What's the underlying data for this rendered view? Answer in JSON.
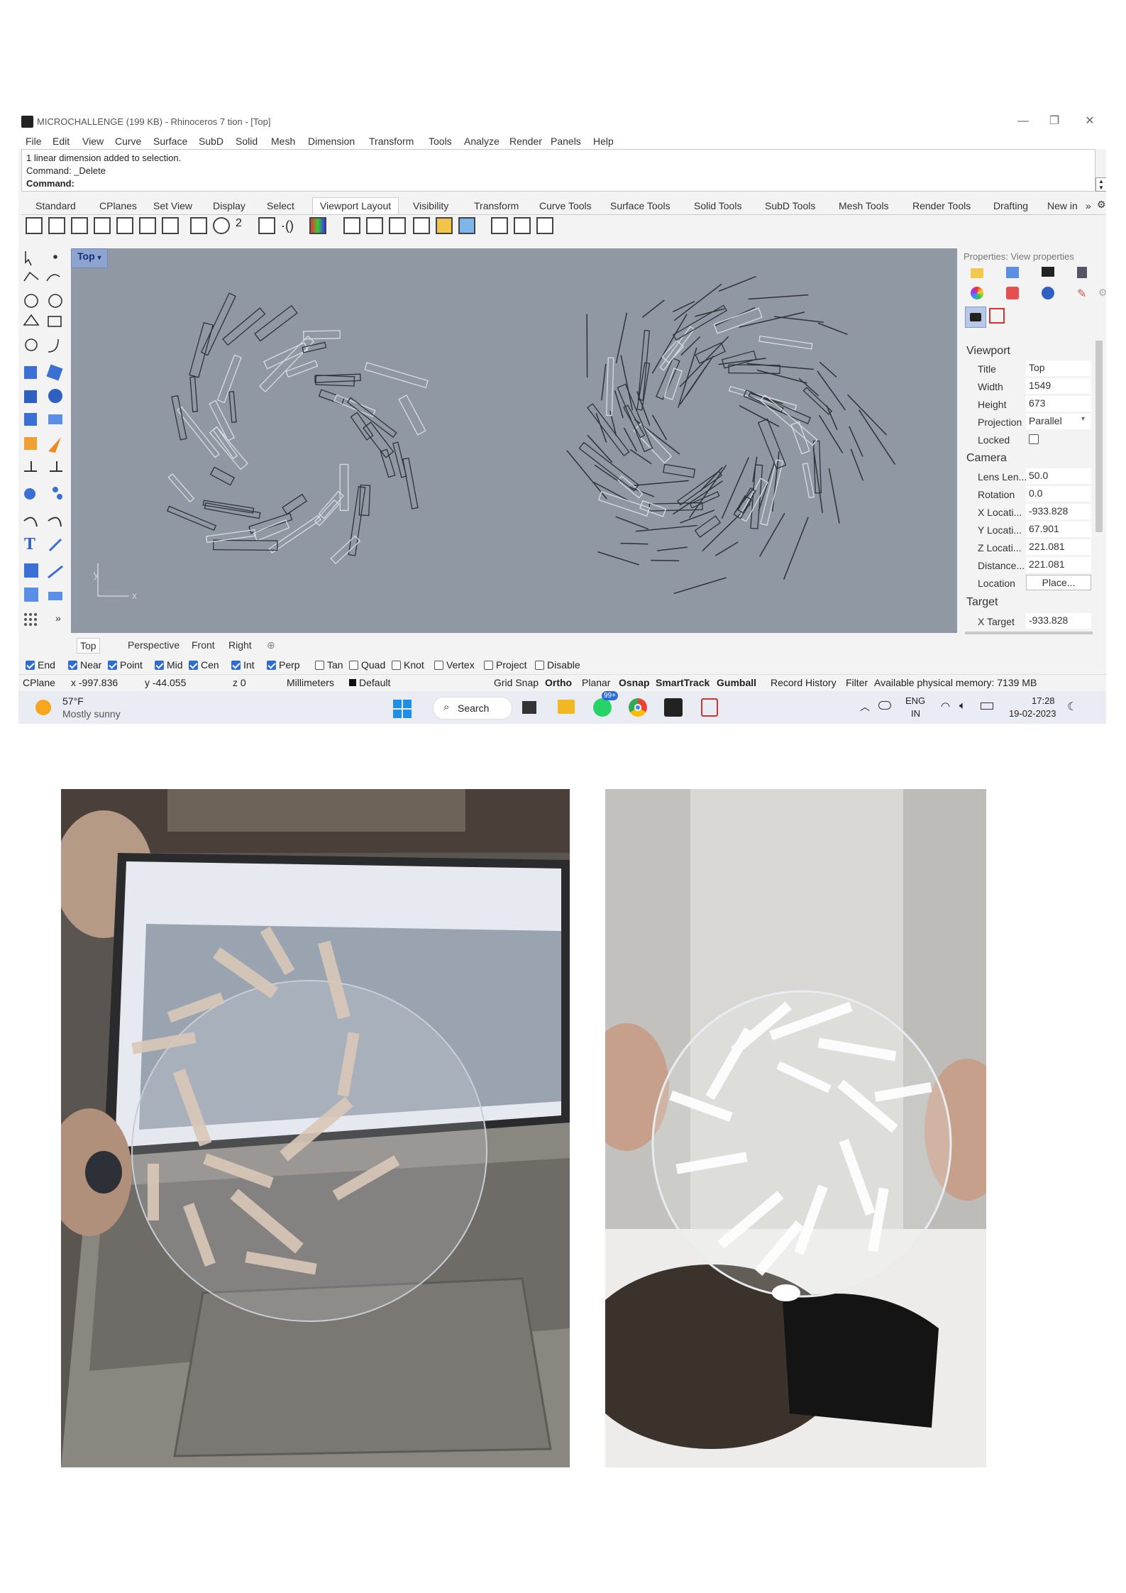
{
  "window": {
    "title": "MICROCHALLENGE (199 KB) - Rhinoceros 7 tion - [Top]",
    "minimize": "—",
    "restore": "❐",
    "close": "✕"
  },
  "menu": [
    "File",
    "Edit",
    "View",
    "Curve",
    "Surface",
    "SubD",
    "Solid",
    "Mesh",
    "Dimension",
    "Transform",
    "Tools",
    "Analyze",
    "Render",
    "Panels",
    "Help"
  ],
  "command": {
    "line1": "1 linear dimension added to selection.",
    "line2": "Command: _Delete",
    "prompt": "Command:"
  },
  "toolbar_tabs": [
    "Standard",
    "CPlanes",
    "Set View",
    "Display",
    "Select",
    "Viewport Layout",
    "Visibility",
    "Transform",
    "Curve Tools",
    "Surface Tools",
    "Solid Tools",
    "SubD Tools",
    "Mesh Tools",
    "Render Tools",
    "Drafting",
    "New in"
  ],
  "toolbar_tabs_more": "»",
  "active_tab": "Viewport Layout",
  "viewport": {
    "label": "Top",
    "axis_y": "y",
    "axis_x": "x",
    "bg_color": "#8f98a3"
  },
  "viewport_tabs": [
    "Top",
    "Perspective",
    "Front",
    "Right"
  ],
  "viewport_tab_add": "⊕",
  "properties": {
    "header": "Properties: View properties",
    "viewport_section": "Viewport",
    "title_label": "Title",
    "title_value": "Top",
    "width_label": "Width",
    "width_value": "1549",
    "height_label": "Height",
    "height_value": "673",
    "projection_label": "Projection",
    "projection_value": "Parallel",
    "locked_label": "Locked",
    "camera_section": "Camera",
    "lens_label": "Lens Len...",
    "lens_value": "50.0",
    "rotation_label": "Rotation",
    "rotation_value": "0.0",
    "xloc_label": "X Locati...",
    "xloc_value": "-933.828",
    "yloc_label": "Y Locati...",
    "yloc_value": "67.901",
    "zloc_label": "Z Locati...",
    "zloc_value": "221.081",
    "distance_label": "Distance...",
    "distance_value": "221.081",
    "location_label": "Location",
    "location_button": "Place...",
    "target_section": "Target",
    "xtarget_label": "X Target",
    "xtarget_value": "-933.828"
  },
  "osnaps": [
    {
      "label": "End",
      "checked": true
    },
    {
      "label": "Near",
      "checked": true
    },
    {
      "label": "Point",
      "checked": true
    },
    {
      "label": "Mid",
      "checked": true
    },
    {
      "label": "Cen",
      "checked": true
    },
    {
      "label": "Int",
      "checked": true
    },
    {
      "label": "Perp",
      "checked": true
    },
    {
      "label": "Tan",
      "checked": false
    },
    {
      "label": "Quad",
      "checked": false
    },
    {
      "label": "Knot",
      "checked": false
    },
    {
      "label": "Vertex",
      "checked": false
    },
    {
      "label": "Project",
      "checked": false
    },
    {
      "label": "Disable",
      "checked": false
    }
  ],
  "status": {
    "cplane": "CPlane",
    "x": "x -997.836",
    "y": "y -44.055",
    "z": "z 0",
    "units": "Millimeters",
    "layer": "Default",
    "grid_snap": "Grid Snap",
    "ortho": "Ortho",
    "planar": "Planar",
    "osnap": "Osnap",
    "smarttrack": "SmartTrack",
    "gumball": "Gumball",
    "record_history": "Record History",
    "filter": "Filter",
    "memory": "Available physical memory: 7139 MB"
  },
  "taskbar": {
    "temp": "57°F",
    "weather": "Mostly sunny",
    "search": "Search",
    "badge": "99+",
    "lang1": "ENG",
    "lang2": "IN",
    "time": "17:28",
    "date": "19-02-2023"
  },
  "colors": {
    "accent": "#2e6bd6",
    "viewport_label_bg": "#8da4ce",
    "line_dark": "#2f3338",
    "line_light": "#d9dde2"
  }
}
